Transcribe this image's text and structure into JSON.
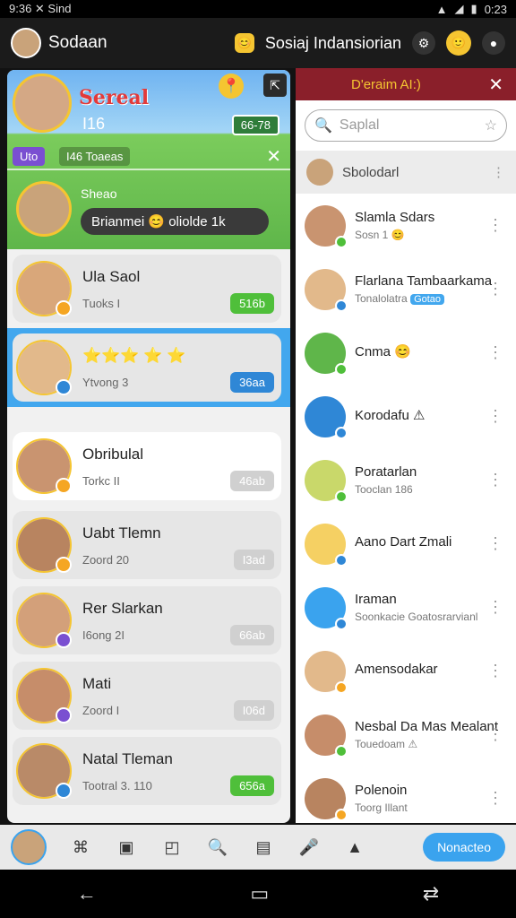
{
  "status": {
    "left": "9:36 ✕ Sind",
    "right": "0:23"
  },
  "app": {
    "title": "Sodaan",
    "subtitle": "Sosiaj Indansiorian"
  },
  "banner": {
    "title": "Sereal",
    "count": "I16",
    "score": "66-78",
    "tag_purple": "Uto",
    "tag_teams": "I46 Toaeas",
    "sub": "Sheao",
    "status": "Brianmei 😊 oliolde 1k"
  },
  "rows": [
    {
      "name": "Ula Saol",
      "sub": "Tuoks I",
      "pill": "516b",
      "pill_color": "#4fbf3a"
    },
    {
      "name": "⭐⭐⭐ ⭐ ⭐",
      "sub": "Ytvong 3",
      "pill": "36aa",
      "pill_color": "#2f87d6"
    },
    {
      "name": "Obribulal",
      "sub": "Torkc II",
      "pill": "46ab",
      "pill_color": "#d0d0d0"
    },
    {
      "name": "Uabt Tlemn",
      "sub": "Zoord 20",
      "pill": "I3ad",
      "pill_color": "#d0d0d0"
    },
    {
      "name": "Rer Slarkan",
      "sub": "I6ong 2I",
      "pill": "66ab",
      "pill_color": "#d0d0d0"
    },
    {
      "name": "Mati",
      "sub": "Zoord I",
      "pill": "I06d",
      "pill_color": "#d0d0d0"
    },
    {
      "name": "Natal Tleman",
      "sub": "Tootral 3. 110",
      "pill": "656a",
      "pill_color": "#4fbf3a"
    }
  ],
  "right_panel": {
    "header": "D'eraim AI:)",
    "search_placeholder": "Saplal",
    "selected": "Sbolodarl",
    "contacts": [
      {
        "name": "Slamla Sdars",
        "sub": "Sosn 1 😊"
      },
      {
        "name": "Flarlana Tambaarkama",
        "sub": "Tonalolatra",
        "tag": "Gotao"
      },
      {
        "name": "Cnma 😊",
        "sub": ""
      },
      {
        "name": "Korodafu ⚠",
        "sub": ""
      },
      {
        "name": "Poratarlan",
        "sub": "Tooclan 186"
      },
      {
        "name": "Aano Dart Zmali",
        "sub": ""
      },
      {
        "name": "Iraman",
        "sub": "Soonkacie Goatosrarvianl"
      },
      {
        "name": "Amensodakar",
        "sub": ""
      },
      {
        "name": "Nesbal Da Mas Mealant",
        "sub": "Touedoam ⚠"
      },
      {
        "name": "Polenoin",
        "sub": "Toorg Illant"
      }
    ]
  },
  "bottom": {
    "button": "Nonacteo"
  }
}
